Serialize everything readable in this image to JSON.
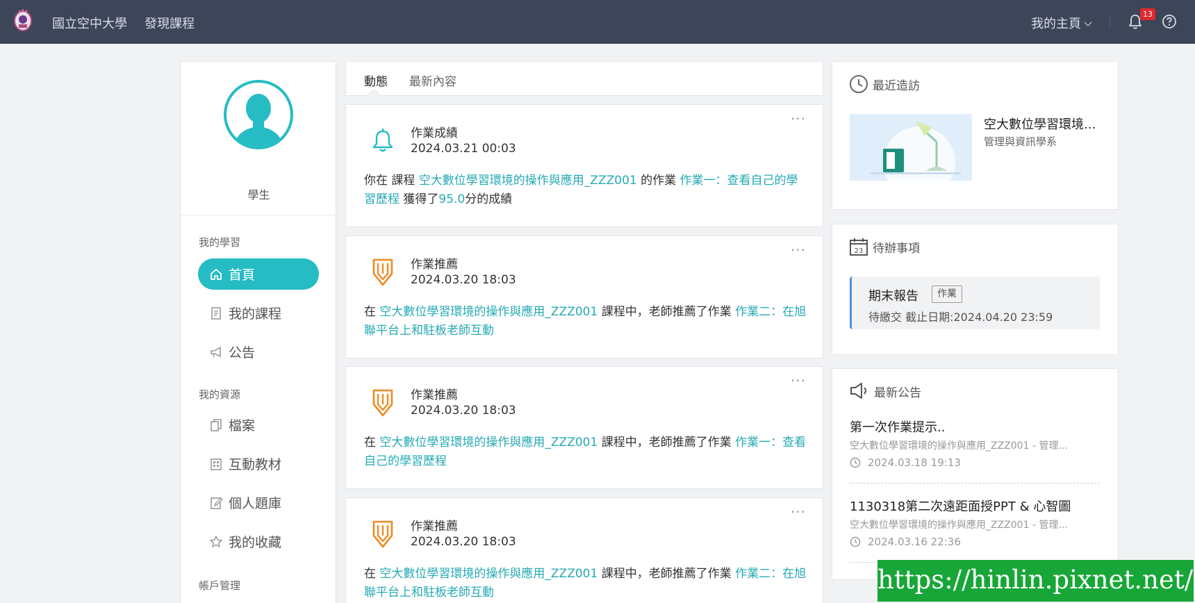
{
  "topbar": {
    "school": "國立空中大學",
    "discover": "發現課程",
    "my_home": "我的主頁",
    "notification_count": "13",
    "icons": [
      "school-logo",
      "bell-icon",
      "help-icon",
      "chevron-down-icon"
    ]
  },
  "profile": {
    "role": "學生"
  },
  "sidebar": {
    "section_learning": "我的學習",
    "section_resources": "我的資源",
    "section_account": "帳戶管理",
    "items": [
      {
        "label": "首頁",
        "icon": "home-icon"
      },
      {
        "label": "我的課程",
        "icon": "document-icon"
      },
      {
        "label": "公告",
        "icon": "megaphone-icon"
      },
      {
        "label": "檔案",
        "icon": "files-icon"
      },
      {
        "label": "互動教材",
        "icon": "building-icon"
      },
      {
        "label": "個人題庫",
        "icon": "edit-icon"
      },
      {
        "label": "我的收藏",
        "icon": "star-icon"
      }
    ]
  },
  "tabs": [
    "動態",
    "最新內容"
  ],
  "feed": [
    {
      "title": "作業成績",
      "time": "2024.03.21 00:03",
      "icon": "bell-icon",
      "p1": "你在 課程 ",
      "course": "空大數位學習環境的操作與應用_ZZZ001",
      "p2": " 的作業 ",
      "assignment": "作業一：查看自己的學習歷程",
      "p3": " 獲得了",
      "score": "95.0",
      "p4": "分的成績"
    },
    {
      "title": "作業推薦",
      "time": "2024.03.20 18:03",
      "icon": "pencil-badge-icon",
      "p1": "在 ",
      "course": "空大數位學習環境的操作與應用_ZZZ001",
      "p2": " 課程中，老師推薦了作業 ",
      "assignment": "作業二：在旭聯平台上和駐板老師互動"
    },
    {
      "title": "作業推薦",
      "time": "2024.03.20 18:03",
      "icon": "pencil-badge-icon",
      "p1": "在 ",
      "course": "空大數位學習環境的操作與應用_ZZZ001",
      "p2": " 課程中，老師推薦了作業 ",
      "assignment": "作業一：查看自己的學習歷程"
    },
    {
      "title": "作業推薦",
      "time": "2024.03.20 18:03",
      "icon": "pencil-badge-icon",
      "p1": "在 ",
      "course": "空大數位學習環境的操作與應用_ZZZ001",
      "p2": " 課程中，老師推薦了作業 ",
      "assignment": "作業二：在旭聯平台上和駐板老師互動"
    }
  ],
  "recent": {
    "heading": "最近造訪",
    "title": "空大數位學習環境...",
    "subtitle": "管理與資訊學系"
  },
  "todo": {
    "heading": "待辦事項",
    "calendar_day": "23",
    "title": "期末報告",
    "tag": "作業",
    "meta": "待繳交 截止日期:2024.04.20 23:59"
  },
  "announcements": {
    "heading": "最新公告",
    "items": [
      {
        "title": "第一次作業提示..",
        "course": "空大數位學習環境的操作與應用_ZZZ001 - 管理...",
        "time": "2024.03.18 19:13"
      },
      {
        "title": "1130318第二次遠距面授PPT & 心智圖",
        "course": "空大數位學習環境的操作與應用_ZZZ001 - 管理...",
        "time": "2024.03.16 22:36"
      }
    ]
  },
  "watermark": "https://hinlin.pixnet.net/blog",
  "colors": {
    "topbar": "#3d4559",
    "accent": "#26bcc4",
    "link": "#26aab4",
    "icon_orange": "#f08a24",
    "badge": "#e0282e",
    "watermark": "#17a637"
  }
}
